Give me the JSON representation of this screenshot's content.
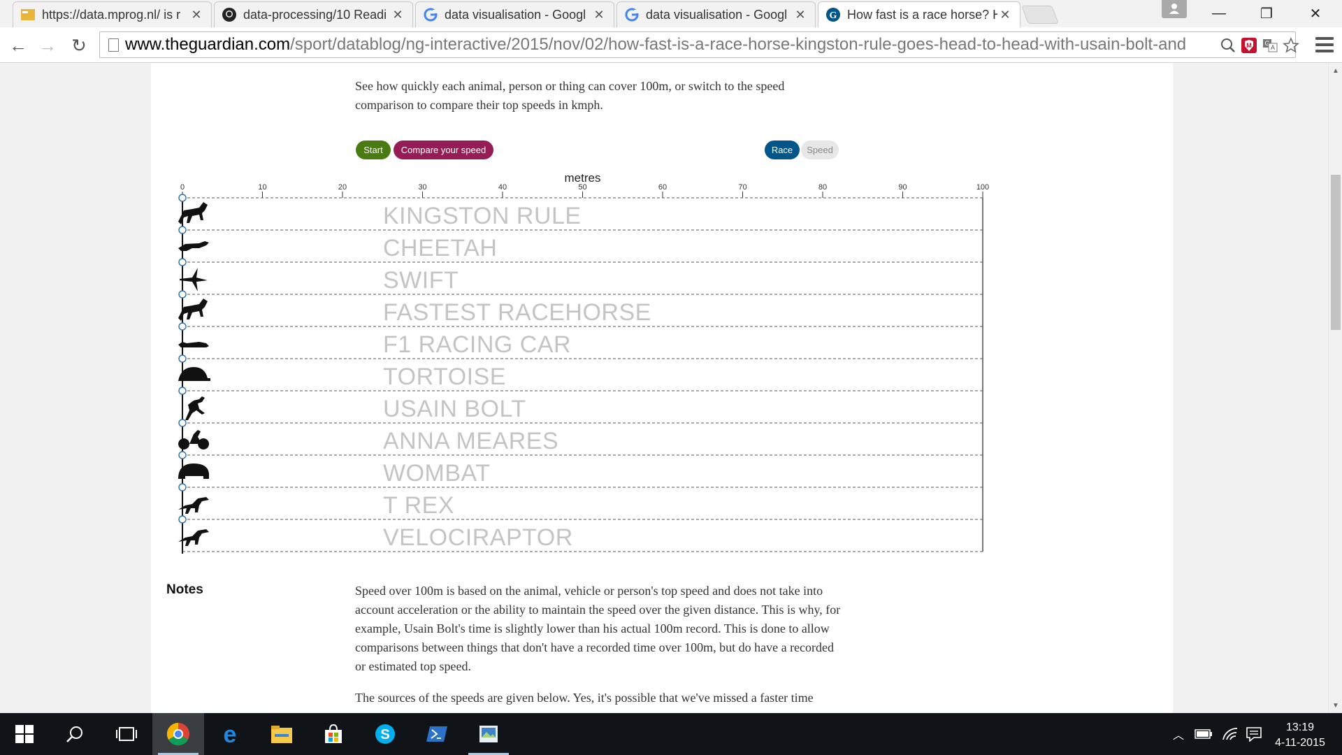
{
  "browser": {
    "tabs": [
      {
        "title": "https://data.mprog.nl/ is r",
        "icon": "mprog-favicon"
      },
      {
        "title": "data-processing/10 Readi",
        "icon": "github-icon"
      },
      {
        "title": "data visualisation - Googl",
        "icon": "google-icon"
      },
      {
        "title": "data visualisation - Googl",
        "icon": "google-icon"
      },
      {
        "title": "How fast is a race horse? H",
        "icon": "guardian-icon",
        "active": true
      }
    ],
    "url_host": "www.theguardian.com",
    "url_path": "/sport/datablog/ng-interactive/2015/nov/02/how-fast-is-a-race-horse-kingston-rule-goes-head-to-head-with-usain-bolt-and"
  },
  "page": {
    "intro": "See how quickly each animal, person or thing can cover 100m, or switch to the speed comparison to compare their top speeds in kmph.",
    "buttons": {
      "start": "Start",
      "compare": "Compare your speed",
      "race": "Race",
      "speed": "Speed"
    },
    "colors": {
      "start": "#4a7a12",
      "compare": "#951c55",
      "race": "#005689",
      "speed_bg": "#e7e7e7",
      "lane_text": "#c4c4c4"
    },
    "notes_heading": "Notes",
    "notes_p1": "Speed over 100m is based on the animal, vehicle or person's top speed and does not take into account acceleration or the ability to maintain the speed over the given distance. This is why, for example, Usain Bolt's time is slightly lower than his actual 100m record. This is done to allow comparisons between things that don't have a recorded time over 100m, but do have a recorded or estimated top speed.",
    "notes_p2": "The sources of the speeds are given below. Yes, it's possible that we've missed a faster time"
  },
  "chart_data": {
    "type": "race-track",
    "xlabel": "metres",
    "xlim": [
      0,
      100
    ],
    "ticks": [
      0,
      10,
      20,
      30,
      40,
      50,
      60,
      70,
      80,
      90,
      100
    ],
    "lanes": [
      {
        "label": "KINGSTON RULE",
        "icon": "horse-icon",
        "position_m": 0
      },
      {
        "label": "CHEETAH",
        "icon": "cheetah-icon",
        "position_m": 0
      },
      {
        "label": "SWIFT",
        "icon": "bird-icon",
        "position_m": 0
      },
      {
        "label": "FASTEST RACEHORSE",
        "icon": "horse-icon",
        "position_m": 0
      },
      {
        "label": "F1 RACING CAR",
        "icon": "race-car-icon",
        "position_m": 0
      },
      {
        "label": "TORTOISE",
        "icon": "tortoise-icon",
        "position_m": 0
      },
      {
        "label": "USAIN BOLT",
        "icon": "runner-icon",
        "position_m": 0
      },
      {
        "label": "ANNA MEARES",
        "icon": "cyclist-icon",
        "position_m": 0
      },
      {
        "label": "WOMBAT",
        "icon": "wombat-icon",
        "position_m": 0
      },
      {
        "label": "T REX",
        "icon": "dinosaur-icon",
        "position_m": 0
      },
      {
        "label": "VELOCIRAPTOR",
        "icon": "dinosaur-icon",
        "position_m": 0
      }
    ]
  },
  "taskbar": {
    "time": "13:19",
    "date": "4-11-2015"
  }
}
